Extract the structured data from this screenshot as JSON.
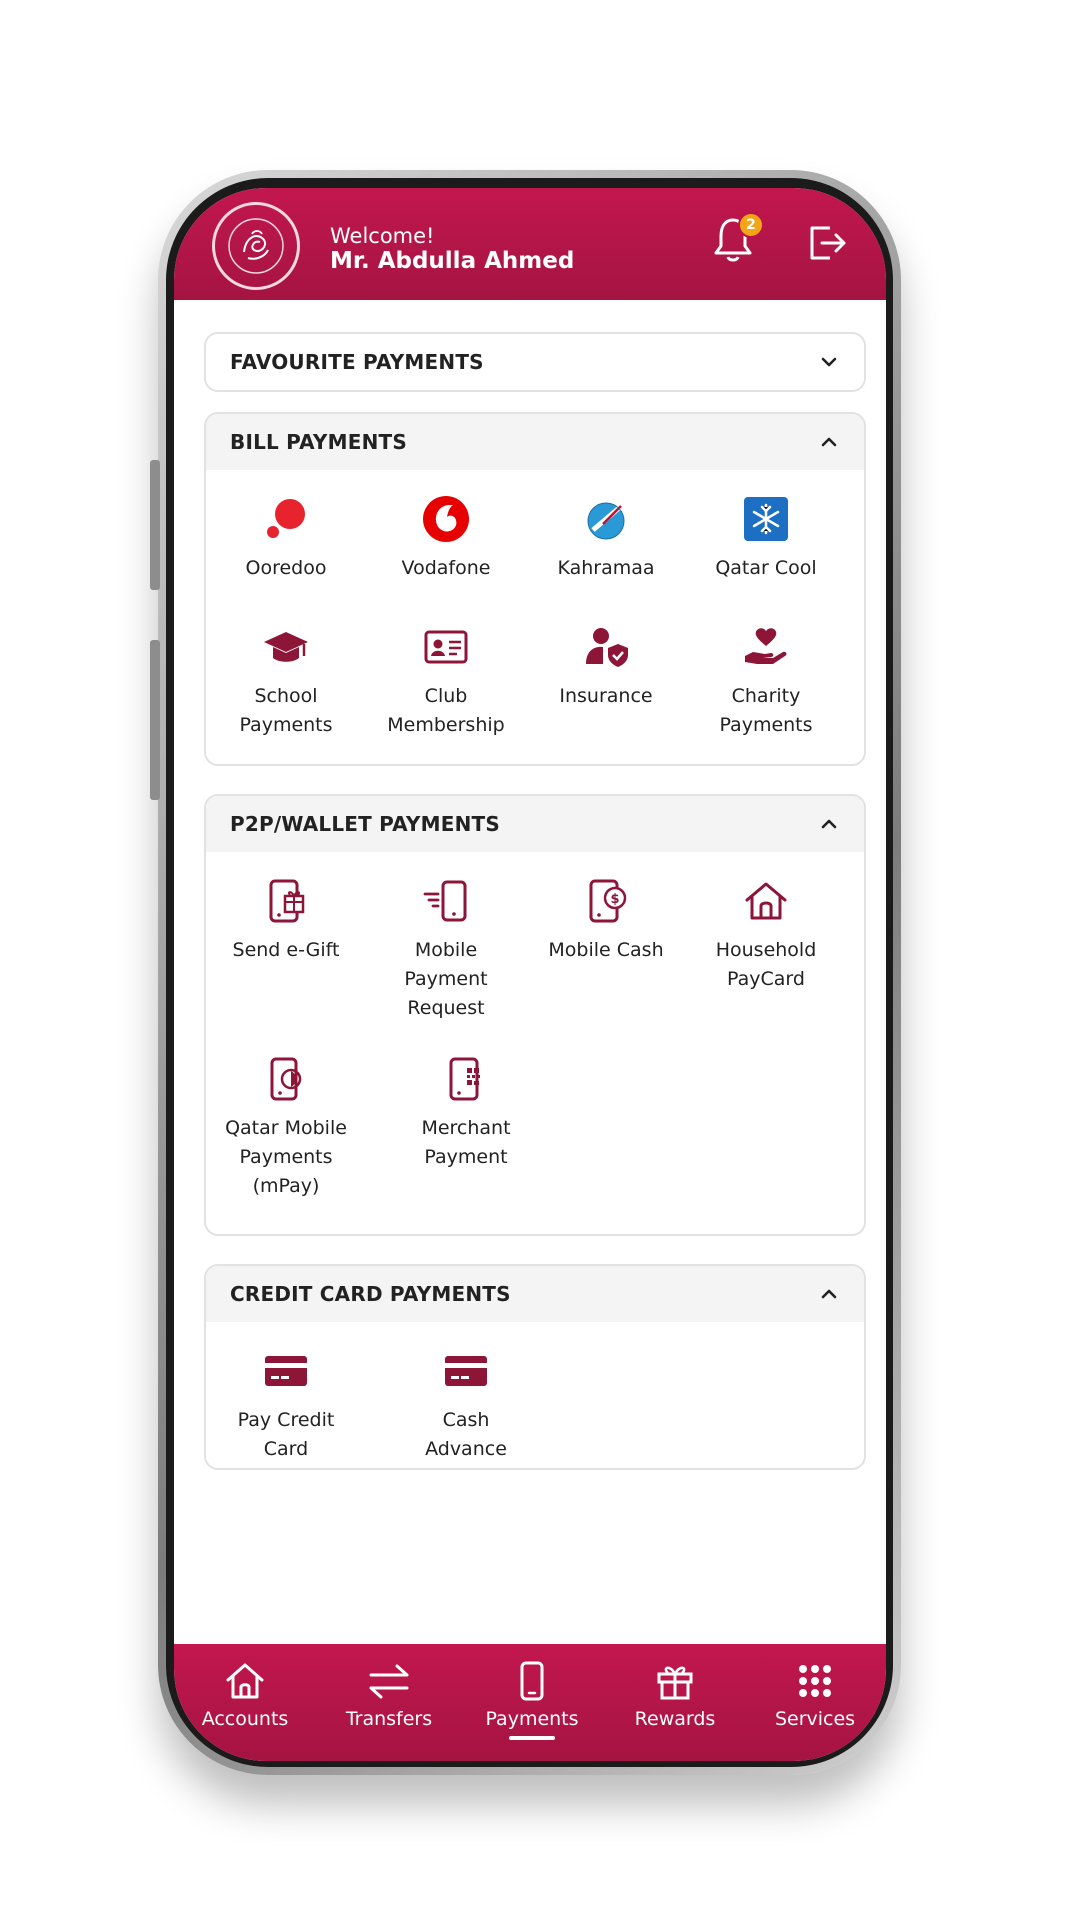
{
  "header": {
    "welcome": "Welcome!",
    "user_name": "Mr. Abdulla Ahmed",
    "notification_count": "2"
  },
  "sections": {
    "favourite": {
      "title": "FAVOURITE PAYMENTS"
    },
    "bill": {
      "title": "BILL PAYMENTS",
      "items": [
        {
          "label": "Ooredoo",
          "icon": "ooredoo-icon"
        },
        {
          "label": "Vodafone",
          "icon": "vodafone-icon"
        },
        {
          "label": "Kahramaa",
          "icon": "kahramaa-icon"
        },
        {
          "label": "Qatar Cool",
          "icon": "qatar-cool-icon"
        },
        {
          "label": "School\nPayments",
          "icon": "graduation-cap-icon"
        },
        {
          "label": "Club\nMembership",
          "icon": "id-card-icon"
        },
        {
          "label": "Insurance",
          "icon": "person-shield-icon"
        },
        {
          "label": "Charity\nPayments",
          "icon": "hand-heart-icon"
        }
      ]
    },
    "p2p": {
      "title": "P2P/WALLET PAYMENTS",
      "items": [
        {
          "label": "Send e-Gift",
          "icon": "phone-gift-icon"
        },
        {
          "label": "Mobile\nPayment\nRequest",
          "icon": "phone-request-icon"
        },
        {
          "label": "Mobile Cash",
          "icon": "phone-cash-icon"
        },
        {
          "label": "Household\nPayCard",
          "icon": "house-icon"
        },
        {
          "label": "Qatar Mobile\nPayments\n(mPay)",
          "icon": "phone-mpay-icon"
        },
        {
          "label": "Merchant\nPayment",
          "icon": "phone-qr-icon"
        }
      ]
    },
    "credit": {
      "title": "CREDIT CARD PAYMENTS",
      "items": [
        {
          "label": "Pay Credit\nCard",
          "icon": "credit-card-icon"
        },
        {
          "label": "Cash\nAdvance",
          "icon": "credit-card-icon"
        }
      ]
    }
  },
  "nav": [
    {
      "label": "Accounts",
      "icon": "home-icon"
    },
    {
      "label": "Transfers",
      "icon": "transfer-arrows-icon"
    },
    {
      "label": "Payments",
      "icon": "phone-icon",
      "active": true
    },
    {
      "label": "Rewards",
      "icon": "gift-icon"
    },
    {
      "label": "Services",
      "icon": "grid-dots-icon"
    }
  ],
  "colors": {
    "brand": "#b3164a",
    "icon": "#8c1538"
  }
}
